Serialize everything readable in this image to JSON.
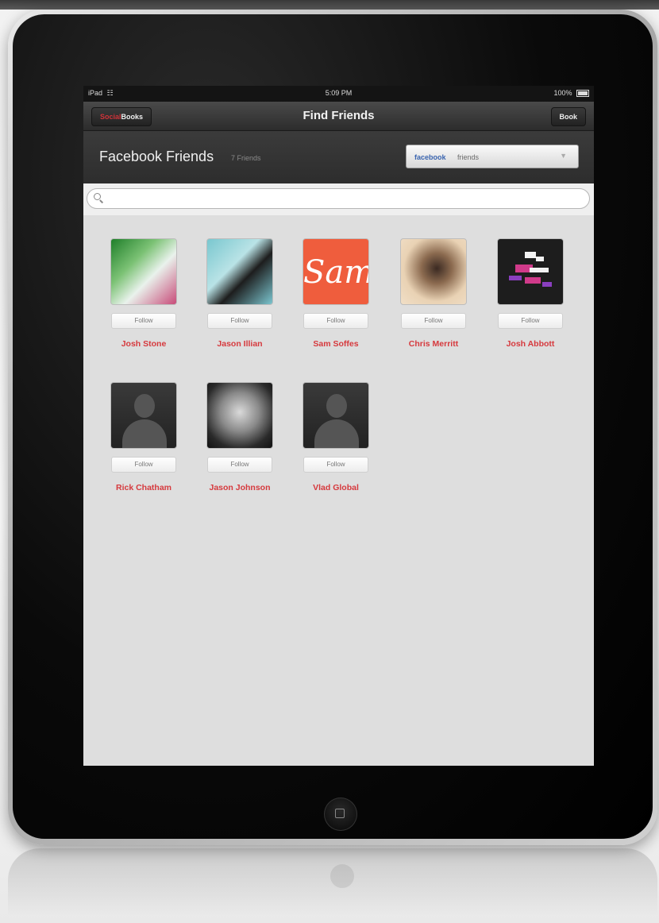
{
  "status_bar": {
    "device": "iPad",
    "time": "5:09 PM",
    "battery": "100%"
  },
  "nav": {
    "logo_social": "Social",
    "logo_books": "Books",
    "title": "Find Friends",
    "book_button": "Book"
  },
  "header": {
    "title": "Facebook Friends",
    "count": "7 Friends",
    "source_select": {
      "brand": "facebook",
      "label": "friends"
    }
  },
  "search": {
    "placeholder": ""
  },
  "friends": [
    {
      "name": "Josh Stone",
      "button": "Follow"
    },
    {
      "name": "Jason Illian",
      "button": "Follow"
    },
    {
      "name": "Sam Soffes",
      "button": "Follow",
      "avatar_text": "Sam"
    },
    {
      "name": "Chris Merritt",
      "button": "Follow"
    },
    {
      "name": "Josh Abbott",
      "button": "Follow"
    },
    {
      "name": "Rick Chatham",
      "button": "Follow"
    },
    {
      "name": "Jason Johnson",
      "button": "Follow"
    },
    {
      "name": "Vlad Global",
      "button": "Follow"
    }
  ],
  "colors": {
    "accent": "#d6393d",
    "facebook_brand": "#3b65b0",
    "navbar": "#2c2c2c"
  }
}
